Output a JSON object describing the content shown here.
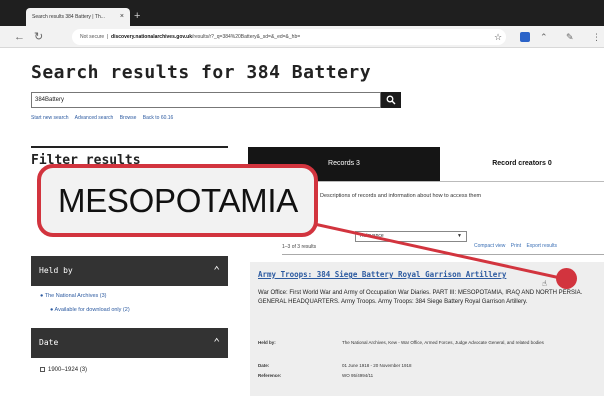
{
  "browser": {
    "tab_title": "Search results 384 Battery | Th...",
    "tab_close": "×",
    "new_tab": "+",
    "insecure_label": "Not secure",
    "url_domain": "discovery.nationalarchives.gov.uk",
    "url_rest": "/results/r?_q=384%20Battery&_sd=&_ed=&_hb=",
    "icons": [
      "back-icon",
      "reload-icon",
      "star-icon",
      "extension-icon",
      "menu-icon"
    ]
  },
  "search": {
    "title": "Search results for 384 Battery",
    "query": "384Battery",
    "links": [
      "Start new search",
      "Advanced search",
      "Browse",
      "Back to 60.16"
    ]
  },
  "sidebar": {
    "filter_title": "Filter results",
    "held_by_label": "Held by",
    "held_items": [
      "The National Archives (3)",
      "Available for download only (2)"
    ],
    "date_label": "Date",
    "date_items": [
      "1900–1924 (3)"
    ]
  },
  "tabs": {
    "records": "Records 3",
    "creators": "Record creators 0"
  },
  "results": {
    "description_text": "Descriptions of records and information about how to access them",
    "count": "1–3 of 3 results",
    "sort_value": "Relevance",
    "view_links": [
      "Compact view",
      "Print",
      "Export results"
    ],
    "item": {
      "title": "Army Troops: 384 Siege Battery Royal Garrison Artillery",
      "description": "War Office: First World War and Army of Occupation War Diaries. PART III: MESOPOTAMIA, IRAQ AND NORTH PERSIA. GENERAL HEADQUARTERS. Army Troops. Army Troops: 384 Siege Battery Royal Garrison Artillery.",
      "meta": [
        {
          "label": "Held by:",
          "value": "The National Archives, Kew - War Office, Armed Forces, Judge Advocate General, and related bodies"
        },
        {
          "label": "Date:",
          "value": "01 June 1918 - 20 November 1918"
        },
        {
          "label": "Reference:",
          "value": "WO 95/4994/11"
        }
      ]
    }
  },
  "callout": {
    "text": "MESOPOTAMIA",
    "color": "#d2343e"
  }
}
